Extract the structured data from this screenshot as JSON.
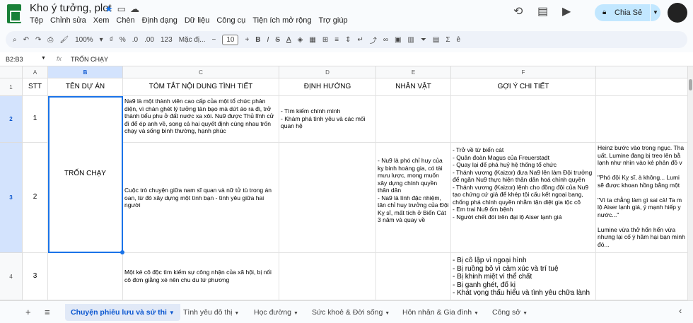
{
  "app": {
    "title": "Kho ý tưởng, plot",
    "menu": [
      "Tệp",
      "Chỉnh sửa",
      "Xem",
      "Chèn",
      "Định dạng",
      "Dữ liệu",
      "Công cụ",
      "Tiện ích mở rộng",
      "Trợ giúp"
    ],
    "share_label": "Chia Sẻ"
  },
  "toolbar": {
    "zoom": "100%",
    "percent": "%",
    "decimal_dec": ".0",
    "decimal_inc": ".00",
    "number_format": "123",
    "font": "Mặc đị...",
    "font_size": "10",
    "bold": "B",
    "italic": "I",
    "strike": "S",
    "text_color": "A"
  },
  "formula_bar": {
    "name_box": "B2:B3",
    "fx": "fx",
    "value": "TRỐN CHẠY"
  },
  "columns": [
    "A",
    "B",
    "C",
    "D",
    "E",
    "F"
  ],
  "rows": [
    "1",
    "2",
    "3",
    "4"
  ],
  "header_row": {
    "a": "STT",
    "b": "TÊN DỰ ÁN",
    "c": "TÓM TẮT NỘI DUNG TÌNH TIẾT",
    "d": "ĐỊNH HƯỚNG",
    "e": "NHÂN VẬT",
    "f": "GỢI Ý CHI TIẾT"
  },
  "row2": {
    "a": "1",
    "c": "Na9 là một thành viên cao cấp của một tổ chức phản diện, vì chán ghét lý tưởng tàn bạo mà dứt áo ra đi, trở thành tiểu phu ở đất nước xa xôi. Nu9 được Thủ lĩnh cử đi để ép anh về, song cả hai quyết định cùng nhau trốn chạy và sống bình thường, hạnh phúc",
    "d": "- Tìm kiếm chính mình\n- Khám phá tình yêu và các mối quan hệ"
  },
  "row3": {
    "a": "2",
    "b": "TRỐN CHẠY",
    "c": "Cuộc trò chuyện giữa nam sĩ quan và nữ tử tù trong án oan, từ đó xây dựng một tình bạn - tình yêu giữa hai người",
    "e": "- Nu9 là phó chỉ huy của kỵ binh hoàng gia, có tài mưu lược, mong muốn xây dựng chính quyền thân dân\n- Na9 là lính đặc nhiệm, tân chỉ huy trưởng của Đội Kỵ sĩ, mất tích ở Biển Cát 3 năm và quay về",
    "f": "- Trở về từ biển cát\n- Quân đoàn Magus của Freuerstadt\n- Quay lại để phá huỷ hệ thống tổ chức\n- Thánh vương (Kaizor) đưa Na9 lên làm Đội trưởng để ngăn Nu9 thực hiện thân dân hoá chính quyền\n- Thánh vương (Kaizor) lệnh cho đồng đội của Nu9 tạo chứng cứ giả để khép tội cấu kết ngoại bang, chống phá chính quyền nhằm tận diệt gia tộc cô\n- Em trai Nu9 ốm bệnh\n- Người chết đói trên đại lộ Aiser lạnh giá",
    "g": "Heinz bước vào trong ngục. Tha uất. Lumine đang bị treo lên bằ lạnh như nhìn vào kẻ phản đồ v\n\n\"Phó đội Kỵ sĩ, à không... Lumi sẽ được khoan hồng bằng một\n\n\"Vì ta chẳng làm gì sai cả! Ta m lộ Aiser lạnh giá, ý mạnh hiếp y nước...\"\n\nLumine vừa thở hổn hển vừa nhưng lại cố ý hãm hại bạn mình đó..."
  },
  "row4": {
    "a": "3",
    "c": "Một kẻ cô độc tìm kiếm sự công nhận của xã hội, bị nối cô đơn giằng xé nên chu du tứ phương",
    "f": "- Bị cô lập vì ngoại hình\n- Bị ruồng bỏ vì cảm xúc và trí tuệ\n- Bị khinh miệt vì thể chất\n- Bị ganh ghét, đố kị\n- Khát vọng thấu hiểu và tình yêu chữa lành"
  },
  "sheet_tabs": [
    "Chuyện phiêu lưu và sử thi",
    "Tình yêu đô thị",
    "Học đường",
    "Sức khoẻ & Đời sống",
    "Hôn nhân & Gia đình",
    "Công sở"
  ],
  "icons": [
    "docs-logo",
    "star-icon",
    "folder-icon",
    "cloud-icon",
    "history-icon",
    "comment-icon",
    "video-icon",
    "lock-icon",
    "add-sheet-icon",
    "all-sheets-icon"
  ],
  "colors": {
    "accent": "#1a73e8",
    "share_bg": "#c2e7ff",
    "selection": "#d3e3fd",
    "toolbar_bg": "#eef2f9"
  }
}
